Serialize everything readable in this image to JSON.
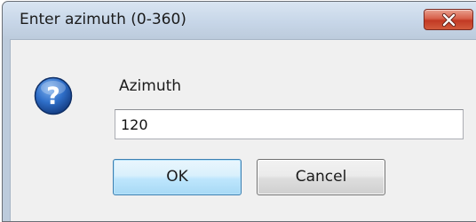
{
  "dialog": {
    "title": "Enter azimuth (0-360)",
    "icon": "question-icon",
    "field": {
      "label": "Azimuth",
      "value": "120"
    },
    "buttons": {
      "ok": "OK",
      "cancel": "Cancel"
    }
  },
  "colors": {
    "titlebar": "#c7d6e8",
    "client_background": "#f0f0f0",
    "close_button": "#c23a24",
    "ok_button_border": "#3c7fb1",
    "icon_blue": "#1f56a8"
  }
}
